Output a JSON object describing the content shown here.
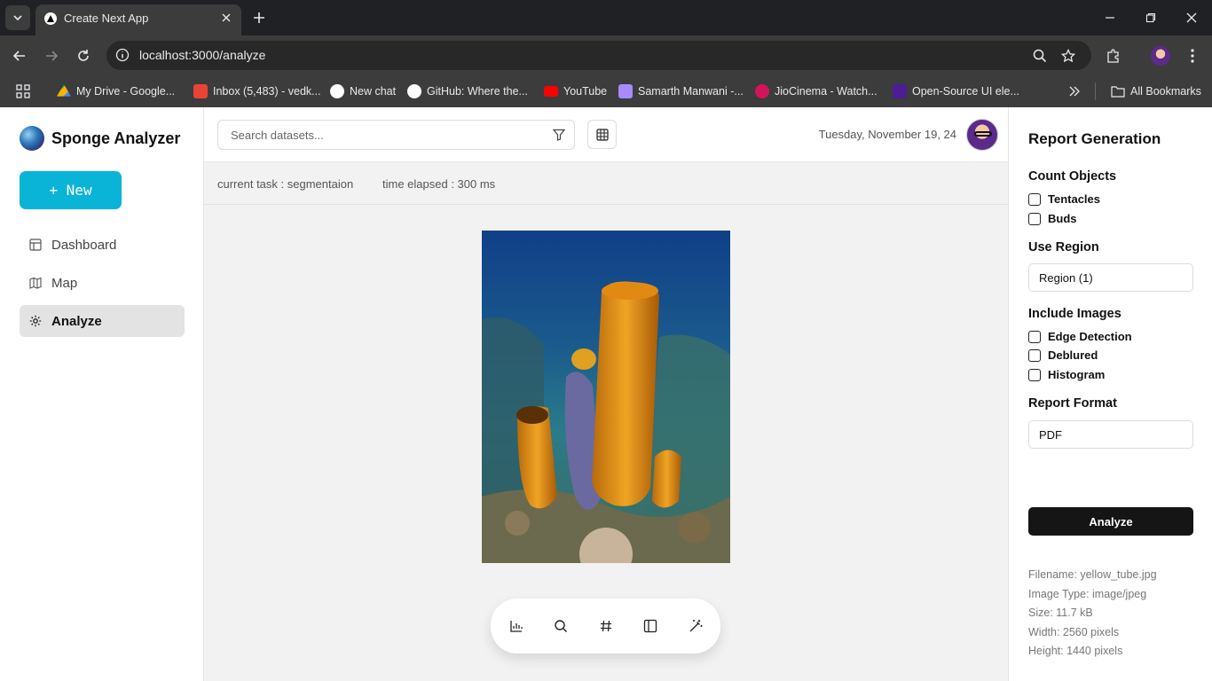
{
  "browser": {
    "tab_title": "Create Next App",
    "url": "localhost:3000/analyze",
    "bookmarks": [
      {
        "label": "My Drive - Google...",
        "color": "#f4b400"
      },
      {
        "label": "Inbox (5,483) - vedk...",
        "color": "#ea4335"
      },
      {
        "label": "New chat",
        "color": "#ffffff"
      },
      {
        "label": "GitHub: Where the...",
        "color": "#ffffff"
      },
      {
        "label": "YouTube",
        "color": "#ff0000"
      },
      {
        "label": "Samarth Manwani -...",
        "color": "#a78bfa"
      },
      {
        "label": "JioCinema - Watch...",
        "color": "#d4145a"
      },
      {
        "label": "Open-Source UI ele...",
        "color": "#4c1d95"
      }
    ],
    "all_bookmarks": "All Bookmarks"
  },
  "sidebar": {
    "brand": "Sponge Analyzer",
    "new_label": "+ New",
    "items": [
      {
        "label": "Dashboard",
        "icon": "layout-icon"
      },
      {
        "label": "Map",
        "icon": "map-icon"
      },
      {
        "label": "Analyze",
        "icon": "gear-icon",
        "active": true
      }
    ]
  },
  "topbar": {
    "search_placeholder": "Search datasets...",
    "date": "Tuesday, November 19, 24"
  },
  "status": {
    "current_task": "current task : segmentaion",
    "time_elapsed": "time elapsed : 300 ms"
  },
  "report": {
    "title": "Report Generation",
    "count_objects": {
      "heading": "Count Objects",
      "options": [
        "Tentacles",
        "Buds"
      ]
    },
    "use_region": {
      "heading": "Use Region",
      "value": "Region (1)"
    },
    "include_images": {
      "heading": "Include Images",
      "options": [
        "Edge Detection",
        "Deblured",
        "Histogram"
      ]
    },
    "report_format": {
      "heading": "Report Format",
      "value": "PDF"
    },
    "analyze_label": "Analyze",
    "meta": {
      "filename": "Filename: yellow_tube.jpg",
      "type": "Image Type: image/jpeg",
      "size": "Size: 11.7 kB",
      "width": "Width: 2560 pixels",
      "height": "Height: 1440 pixels"
    }
  },
  "colors": {
    "accent": "#0ab4d6",
    "dark_button": "#151515"
  }
}
